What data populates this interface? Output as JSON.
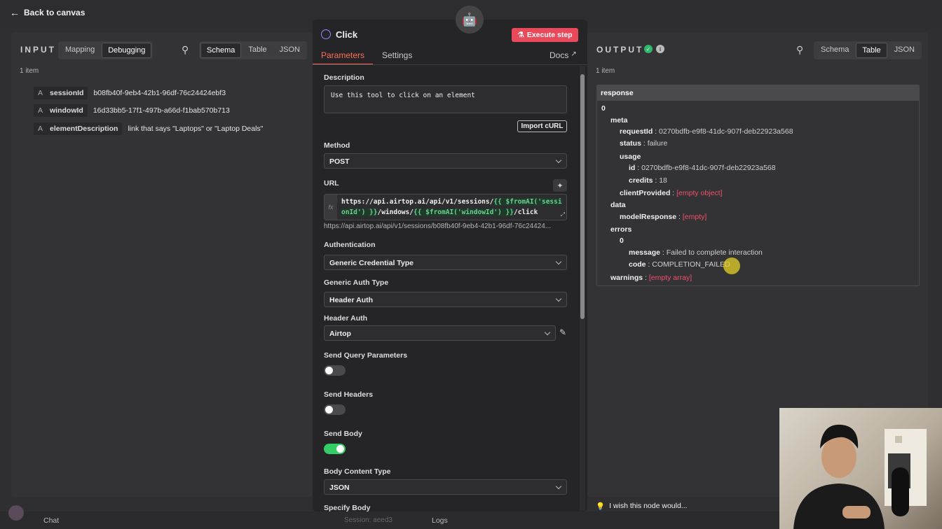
{
  "topbar": {
    "back_label": "Back to canvas"
  },
  "input": {
    "title": "INPUT",
    "modes": [
      "Mapping",
      "Debugging"
    ],
    "views": [
      "Schema",
      "Table",
      "JSON"
    ],
    "active_mode": "Debugging",
    "active_view": "Schema",
    "count": "1 item",
    "fields": [
      {
        "type": "A",
        "name": "sessionId",
        "value": "b08fb40f-9eb4-42b1-96df-76c24424ebf3"
      },
      {
        "type": "A",
        "name": "windowId",
        "value": "16d33bb5-17f1-497b-a66d-f1bab570b713"
      },
      {
        "type": "A",
        "name": "elementDescription",
        "value": "link that says \"Laptops\" or \"Laptop Deals\""
      }
    ]
  },
  "node": {
    "title": "Click",
    "execute_label": "Execute step",
    "tabs": [
      "Parameters",
      "Settings"
    ],
    "active_tab": "Parameters",
    "docs_label": "Docs",
    "description_label": "Description",
    "description_value": "Use this tool to click on an element",
    "import_curl": "Import cURL",
    "method_label": "Method",
    "method_value": "POST",
    "url_label": "URL",
    "url_parts": [
      "https://api.airtop.ai/api/v1/sessions/",
      "{{ $fromAI('sessionId') }}",
      "/windows/",
      "{{ $fromAI('windowId') }}",
      "/click"
    ],
    "url_preview": "https://api.airtop.ai/api/v1/sessions/b08fb40f-9eb4-42b1-96df-76c24424...",
    "auth_label": "Authentication",
    "auth_value": "Generic Credential Type",
    "generic_auth_label": "Generic Auth Type",
    "generic_auth_value": "Header Auth",
    "header_auth_label": "Header Auth",
    "header_auth_value": "Airtop",
    "send_query_label": "Send Query Parameters",
    "send_query_on": false,
    "send_headers_label": "Send Headers",
    "send_headers_on": false,
    "send_body_label": "Send Body",
    "send_body_on": true,
    "body_type_label": "Body Content Type",
    "body_type_value": "JSON",
    "specify_body_label": "Specify Body"
  },
  "output": {
    "title": "OUTPUT",
    "views": [
      "Schema",
      "Table",
      "JSON"
    ],
    "active_view": "Table",
    "count": "1 item",
    "response": {
      "header": "response",
      "index": "0",
      "meta": "meta",
      "requestId_k": "requestId",
      "requestId_v": "0270bdfb-e9f8-41dc-907f-deb22923a568",
      "status_k": "status",
      "status_v": "failure",
      "usage": "usage",
      "id_k": "id",
      "id_v": "0270bdfb-e9f8-41dc-907f-deb22923a568",
      "credits_k": "credits",
      "credits_v": "18",
      "clientProvided_k": "clientProvided",
      "clientProvided_v": "[empty object]",
      "data": "data",
      "modelResponse_k": "modelResponse",
      "modelResponse_v": "[empty]",
      "errors": "errors",
      "err_index": "0",
      "message_k": "message",
      "message_v": "Failed to complete interaction",
      "code_k": "code",
      "code_v": "COMPLETION_FAILED",
      "warnings_k": "warnings",
      "warnings_v": "[empty array]"
    },
    "wish": "I wish this node would..."
  },
  "footer": {
    "chat": "Chat",
    "session": "Session: aeed3",
    "logs": "Logs"
  },
  "colors": {
    "accent": "#ff6d5a",
    "execute": "#e8495b",
    "toggle_on": "#33cc66",
    "error": "#f0506e",
    "success": "#2eb86b"
  }
}
